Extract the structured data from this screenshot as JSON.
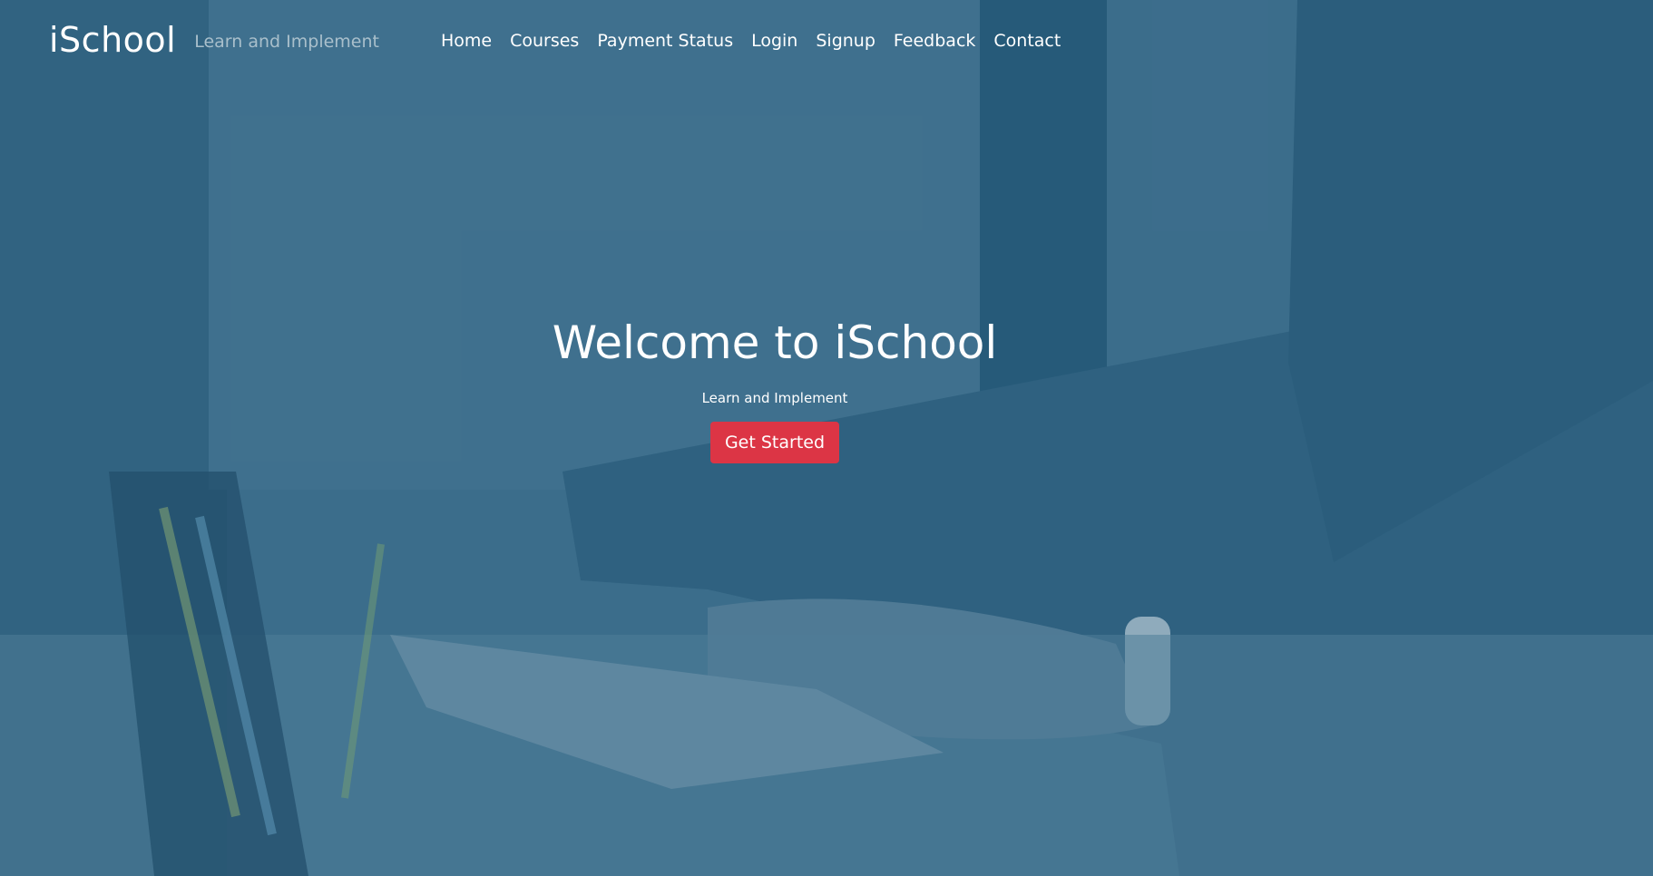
{
  "navbar": {
    "brand": "iSchool",
    "tagline": "Learn and Implement",
    "links": [
      "Home",
      "Courses",
      "Payment Status",
      "Login",
      "Signup",
      "Feedback",
      "Contact"
    ]
  },
  "hero": {
    "title": "Welcome to iSchool",
    "subtitle": "Learn and Implement",
    "cta_label": "Get Started"
  },
  "colors": {
    "overlay": "#1f5a7d",
    "cta": "#dc3545",
    "text": "#ffffff"
  }
}
